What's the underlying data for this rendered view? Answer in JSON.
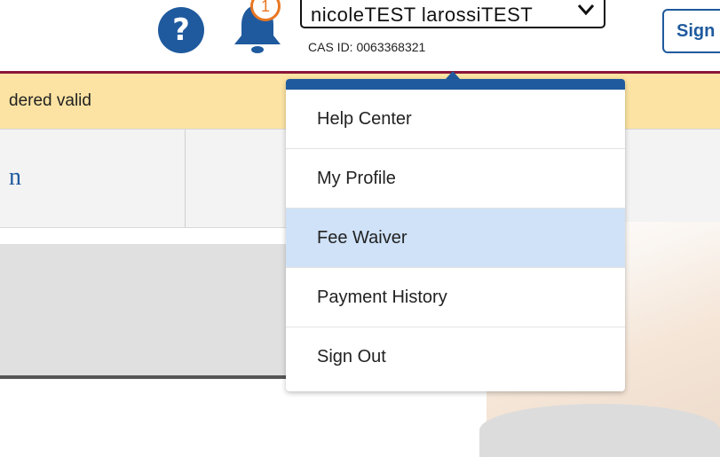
{
  "header": {
    "help_glyph": "?",
    "notification_count": "1",
    "user_name": "nicoleTEST larossiTEST",
    "cas_id": "CAS ID: 0063368321",
    "signout_partial": "Sign"
  },
  "banner": {
    "text": "dered valid"
  },
  "tabs": {
    "partial_label": "n"
  },
  "menu": {
    "items": [
      {
        "label": "Help Center",
        "active": false
      },
      {
        "label": "My Profile",
        "active": false
      },
      {
        "label": "Fee Waiver",
        "active": true
      },
      {
        "label": "Payment History",
        "active": false
      },
      {
        "label": "Sign Out",
        "active": false
      }
    ]
  },
  "colors": {
    "brand_blue": "#1f5a9e",
    "header_rule": "#8a1538",
    "banner_bg": "#fce3a3",
    "notification_orange": "#e87722",
    "menu_highlight": "#cfe2f8"
  },
  "icons": {
    "help": "help-icon",
    "notification": "bell-icon",
    "dropdown": "chevron-down-icon"
  }
}
